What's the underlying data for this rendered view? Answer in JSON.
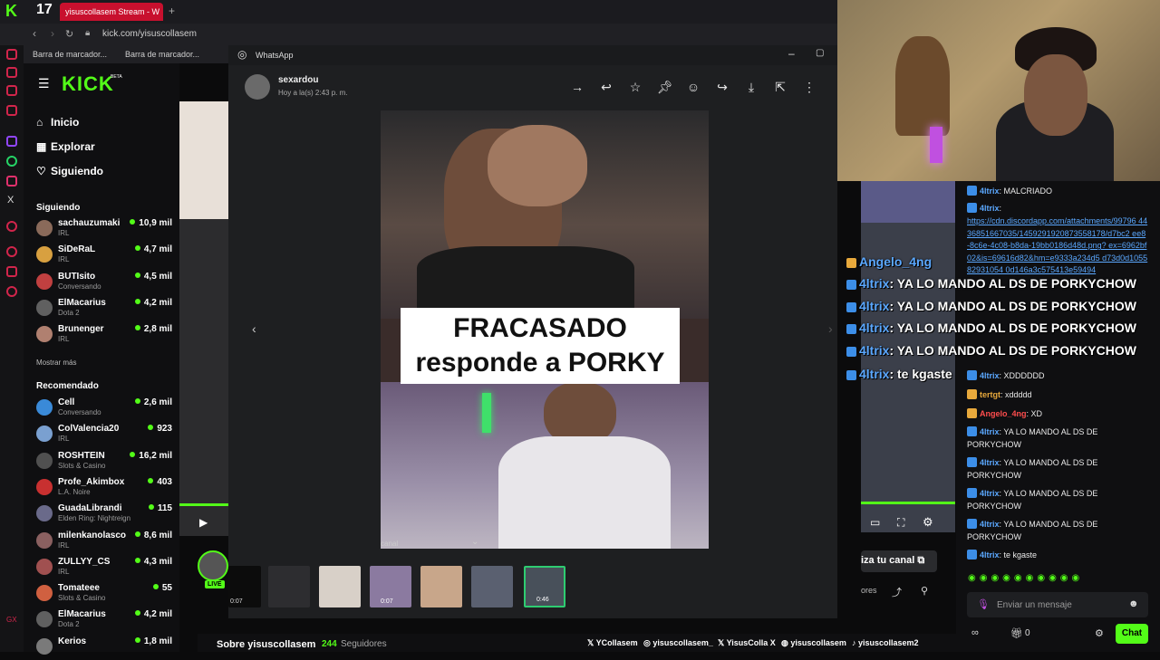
{
  "browser": {
    "tab_title": "yisuscollasem Stream - W",
    "tab_count": "17",
    "url": "kick.com/yisuscollasem",
    "bookmarks": [
      "Barra de marcador...",
      "Barra de marcador..."
    ]
  },
  "kick": {
    "logo": "KICK",
    "beta": "BETA",
    "nav": [
      "Inicio",
      "Explorar",
      "Siguiendo"
    ],
    "following_title": "Siguiendo",
    "show_more": "Mostrar más",
    "recommended_title": "Recomendado",
    "following": [
      {
        "name": "sachauzumaki",
        "cat": "IRL",
        "viewers": "10,9 mil"
      },
      {
        "name": "SiDeRaL",
        "cat": "IRL",
        "viewers": "4,7 mil"
      },
      {
        "name": "BUTIsito",
        "cat": "Conversando",
        "viewers": "4,5 mil"
      },
      {
        "name": "ElMacarius",
        "cat": "Dota 2",
        "viewers": "4,2 mil"
      },
      {
        "name": "Brunenger",
        "cat": "IRL",
        "viewers": "2,8 mil"
      }
    ],
    "recommended": [
      {
        "name": "Cell",
        "cat": "Conversando",
        "viewers": "2,6 mil"
      },
      {
        "name": "ColValencia20",
        "cat": "IRL",
        "viewers": "923"
      },
      {
        "name": "ROSHTEIN",
        "cat": "Slots & Casino",
        "viewers": "16,2 mil"
      },
      {
        "name": "Profe_Akimbox",
        "cat": "L.A. Noire",
        "viewers": "403"
      },
      {
        "name": "GuadaLibrandi",
        "cat": "Elden Ring: Nightreign",
        "viewers": "115"
      },
      {
        "name": "milenkanolasco",
        "cat": "IRL",
        "viewers": "8,6 mil"
      },
      {
        "name": "ZULLYY_CS",
        "cat": "IRL",
        "viewers": "4,3 mil"
      },
      {
        "name": "Tomateee",
        "cat": "Slots & Casino",
        "viewers": "55"
      },
      {
        "name": "ElMacarius",
        "cat": "Dota 2",
        "viewers": "4,2 mil"
      },
      {
        "name": "Kerios",
        "cat": "",
        "viewers": "1,8 mil"
      }
    ]
  },
  "whatsapp": {
    "app_title": "WhatsApp",
    "sender": "sexardou",
    "timestamp": "Hoy a la(s) 2:43 p. m.",
    "caption_line1": "FRACASADO",
    "caption_line2": "responde a PORKY",
    "thumb_time1": "0:07",
    "thumb_time2": "0:07",
    "thumb_time3": "0:46",
    "bottom_text": "canal"
  },
  "stream": {
    "live_badge": "LIVE",
    "about_title": "Sobre yisuscollasem",
    "followers": "244",
    "followers_label": "Seguidores",
    "subscribe_label": "iza tu canal",
    "more_label": "ores",
    "socials": [
      "YCollasem",
      "yisuscollasem_",
      "YisusColla X",
      "yisuscollasem",
      "yisuscollasem2"
    ]
  },
  "overlay_chat": [
    {
      "user": "Angelo_4ng",
      "text": ""
    },
    {
      "user": "4ltrix",
      "text": ": YA LO MANDO AL DS DE PORKYCHOW"
    },
    {
      "user": "4ltrix",
      "text": ": YA LO MANDO AL DS DE PORKYCHOW"
    },
    {
      "user": "4ltrix",
      "text": ": YA LO MANDO AL DS DE PORKYCHOW"
    },
    {
      "user": "4ltrix",
      "text": ": YA LO MANDO AL DS DE PORKYCHOW"
    },
    {
      "user": "4ltrix",
      "text": ": te kgaste"
    }
  ],
  "chat": {
    "messages": [
      {
        "user": "4ltrix",
        "text": ": MALCRIADO"
      },
      {
        "user": "4ltrix",
        "text": ":"
      },
      {
        "user": "",
        "text": "https://cdn.discordapp.com/attachments/99796 4436851667035/1459291920873558178/d7bc2 ee8-8c6e-4c08-b8da-19bb0186d48d.png? ex=6962bf02&is=69616d82&hm=e9333a234d5 d73d0d105582931054 0d146a3c575413e59494"
      },
      {
        "user": "4ltrix",
        "text": ": XDDDDDD"
      },
      {
        "user": "tertgt",
        "text": ": xddddd"
      },
      {
        "user": "Angelo_4ng",
        "text": ": XD"
      },
      {
        "user": "4ltrix",
        "text": ": YA LO MANDO AL DS DE PORKYCHOW"
      },
      {
        "user": "4ltrix",
        "text": ": YA LO MANDO AL DS DE PORKYCHOW"
      },
      {
        "user": "4ltrix",
        "text": ": YA LO MANDO AL DS DE PORKYCHOW"
      },
      {
        "user": "4ltrix",
        "text": ": YA LO MANDO AL DS DE PORKYCHOW"
      },
      {
        "user": "4ltrix",
        "text": ": te kgaste"
      }
    ],
    "input_placeholder": "Enviar un mensaje",
    "send_label": "Chat",
    "points": "0"
  }
}
